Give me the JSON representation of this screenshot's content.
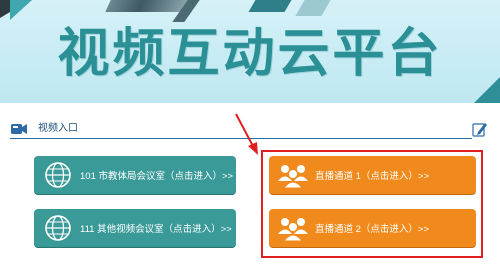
{
  "header": {
    "title": "视频互动云平台"
  },
  "section": {
    "label": "视频入口"
  },
  "channels": [
    {
      "label": "101 市教体局会议室（点击进入）>>",
      "icon": "globe-icon",
      "color": "#3a9a98"
    },
    {
      "label": "111 其他视频会议室（点击进入）>>",
      "icon": "globe-icon",
      "color": "#3a9a98"
    },
    {
      "label": "直播通道 1（点击进入）>>",
      "icon": "audience-icon",
      "color": "#f18a1c"
    },
    {
      "label": "直播通道 2（点击进入）>>",
      "icon": "audience-icon",
      "color": "#f18a1c"
    }
  ],
  "colors": {
    "title": "#2b8f96",
    "teal_button": "#3a9a98",
    "orange_button": "#f18a1c",
    "annotation": "#e02020",
    "section_line": "#2e6ba6"
  }
}
